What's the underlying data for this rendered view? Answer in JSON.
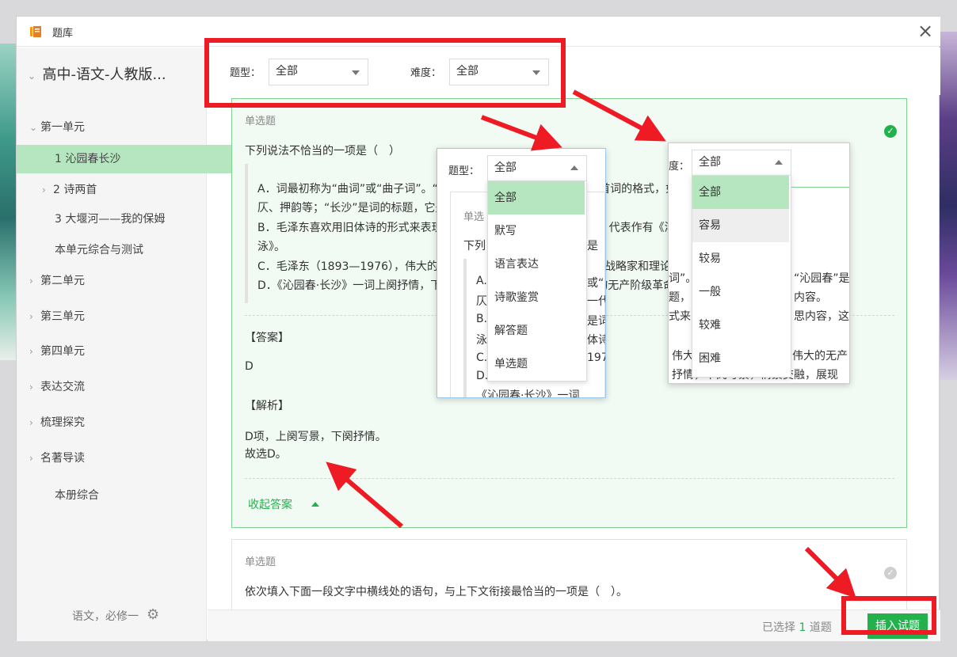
{
  "app": {
    "title": "题库",
    "close_label": "×"
  },
  "sidebar": {
    "book": "高中-语文-人教版...",
    "items": [
      {
        "label": "第一单元",
        "chev": "⌄"
      },
      {
        "label": "1 沁园春长沙",
        "chev": ""
      },
      {
        "label": "2 诗两首",
        "chev": "›"
      },
      {
        "label": "3 大堰河——我的保姆",
        "chev": ""
      },
      {
        "label": "本单元综合与测试",
        "chev": ""
      },
      {
        "label": "第二单元",
        "chev": "›"
      },
      {
        "label": "第三单元",
        "chev": "›"
      },
      {
        "label": "第四单元",
        "chev": "›"
      },
      {
        "label": "表达交流",
        "chev": "›"
      },
      {
        "label": "梳理探究",
        "chev": "›"
      },
      {
        "label": "名著导读",
        "chev": "›"
      },
      {
        "label": "本册综合",
        "chev": ""
      }
    ],
    "footer": "语文，必修一"
  },
  "filters": {
    "type_label": "题型：",
    "type_value": "全部",
    "difficulty_label": "难度：",
    "difficulty_value": "全部"
  },
  "question1": {
    "type": "单选题",
    "stem": "下列说法不恰当的一项是（　）",
    "options": [
      "A．词最初称为“曲词”或“曲子词”。“沁园春”是词的词牌，它决定了这首词的格式，如字数、句数、平",
      "仄、押韵等；“长沙”是词的标题，它是词的内容。",
      "B．毛泽东喜欢用旧体诗的形式来表现新的内容，他的诗词属于现代诗，代表作有《沁园春·雪》《水调歌头·游",
      "泳》。",
      "C．毛泽东（1893—1976），伟大的马克思主义者，无产阶级革命家、战略家和理论家，是一代伟人的楷模。",
      "D．《沁园春·长沙》一词上阕抒情，下阕写景，情景交融，展现了伟大的无产阶级革命家的豪情壮志。"
    ],
    "answer_label": "【答案】",
    "answer": "D",
    "analysis_label": "【解析】",
    "analysis_lines": [
      "D项，上阕写景，下阕抒情。",
      "故选D。"
    ],
    "collapse_label": "收起答案"
  },
  "question2": {
    "type": "单选题",
    "stem": "依次填入下面一段文字中横线处的语句，与上下文衔接最恰当的一项是（　）。"
  },
  "footer": {
    "selected_prefix": "已选择",
    "selected_count": "1",
    "selected_suffix": "道题",
    "insert_label": "插入试题"
  },
  "popup_type": {
    "label": "题型：",
    "value": "全部",
    "options": [
      "全部",
      "默写",
      "语言表达",
      "诗歌鉴赏",
      "解答题",
      "单选题"
    ],
    "selected": "全部",
    "ghost": [
      "单选",
      "下列",
      "A.",
      "仄",
      "B.",
      "泳",
      "C.",
      "D.",
      "是（",
      "或“",
      "一代伟人的楷",
      "是词的",
      "体诗的",
      "1976",
      "《沁园春·长沙》一词"
    ]
  },
  "popup_difficulty": {
    "label": "度：",
    "value": "全部",
    "options": [
      "全部",
      "容易",
      "较易",
      "一般",
      "较难",
      "困难"
    ],
    "selected": "全部",
    "hover": "容易",
    "ghost": [
      "词”。",
      "题，",
      "“沁园春”是",
      "内容。",
      "式来",
      "思内容，这些",
      "伟大",
      "伟大的无产",
      "抒情，下阕写景，情景交融，展现"
    ]
  },
  "colors": {
    "accent": "#22b14c",
    "highlight": "#ee1b24",
    "selected_bg": "#b5e6bf"
  }
}
